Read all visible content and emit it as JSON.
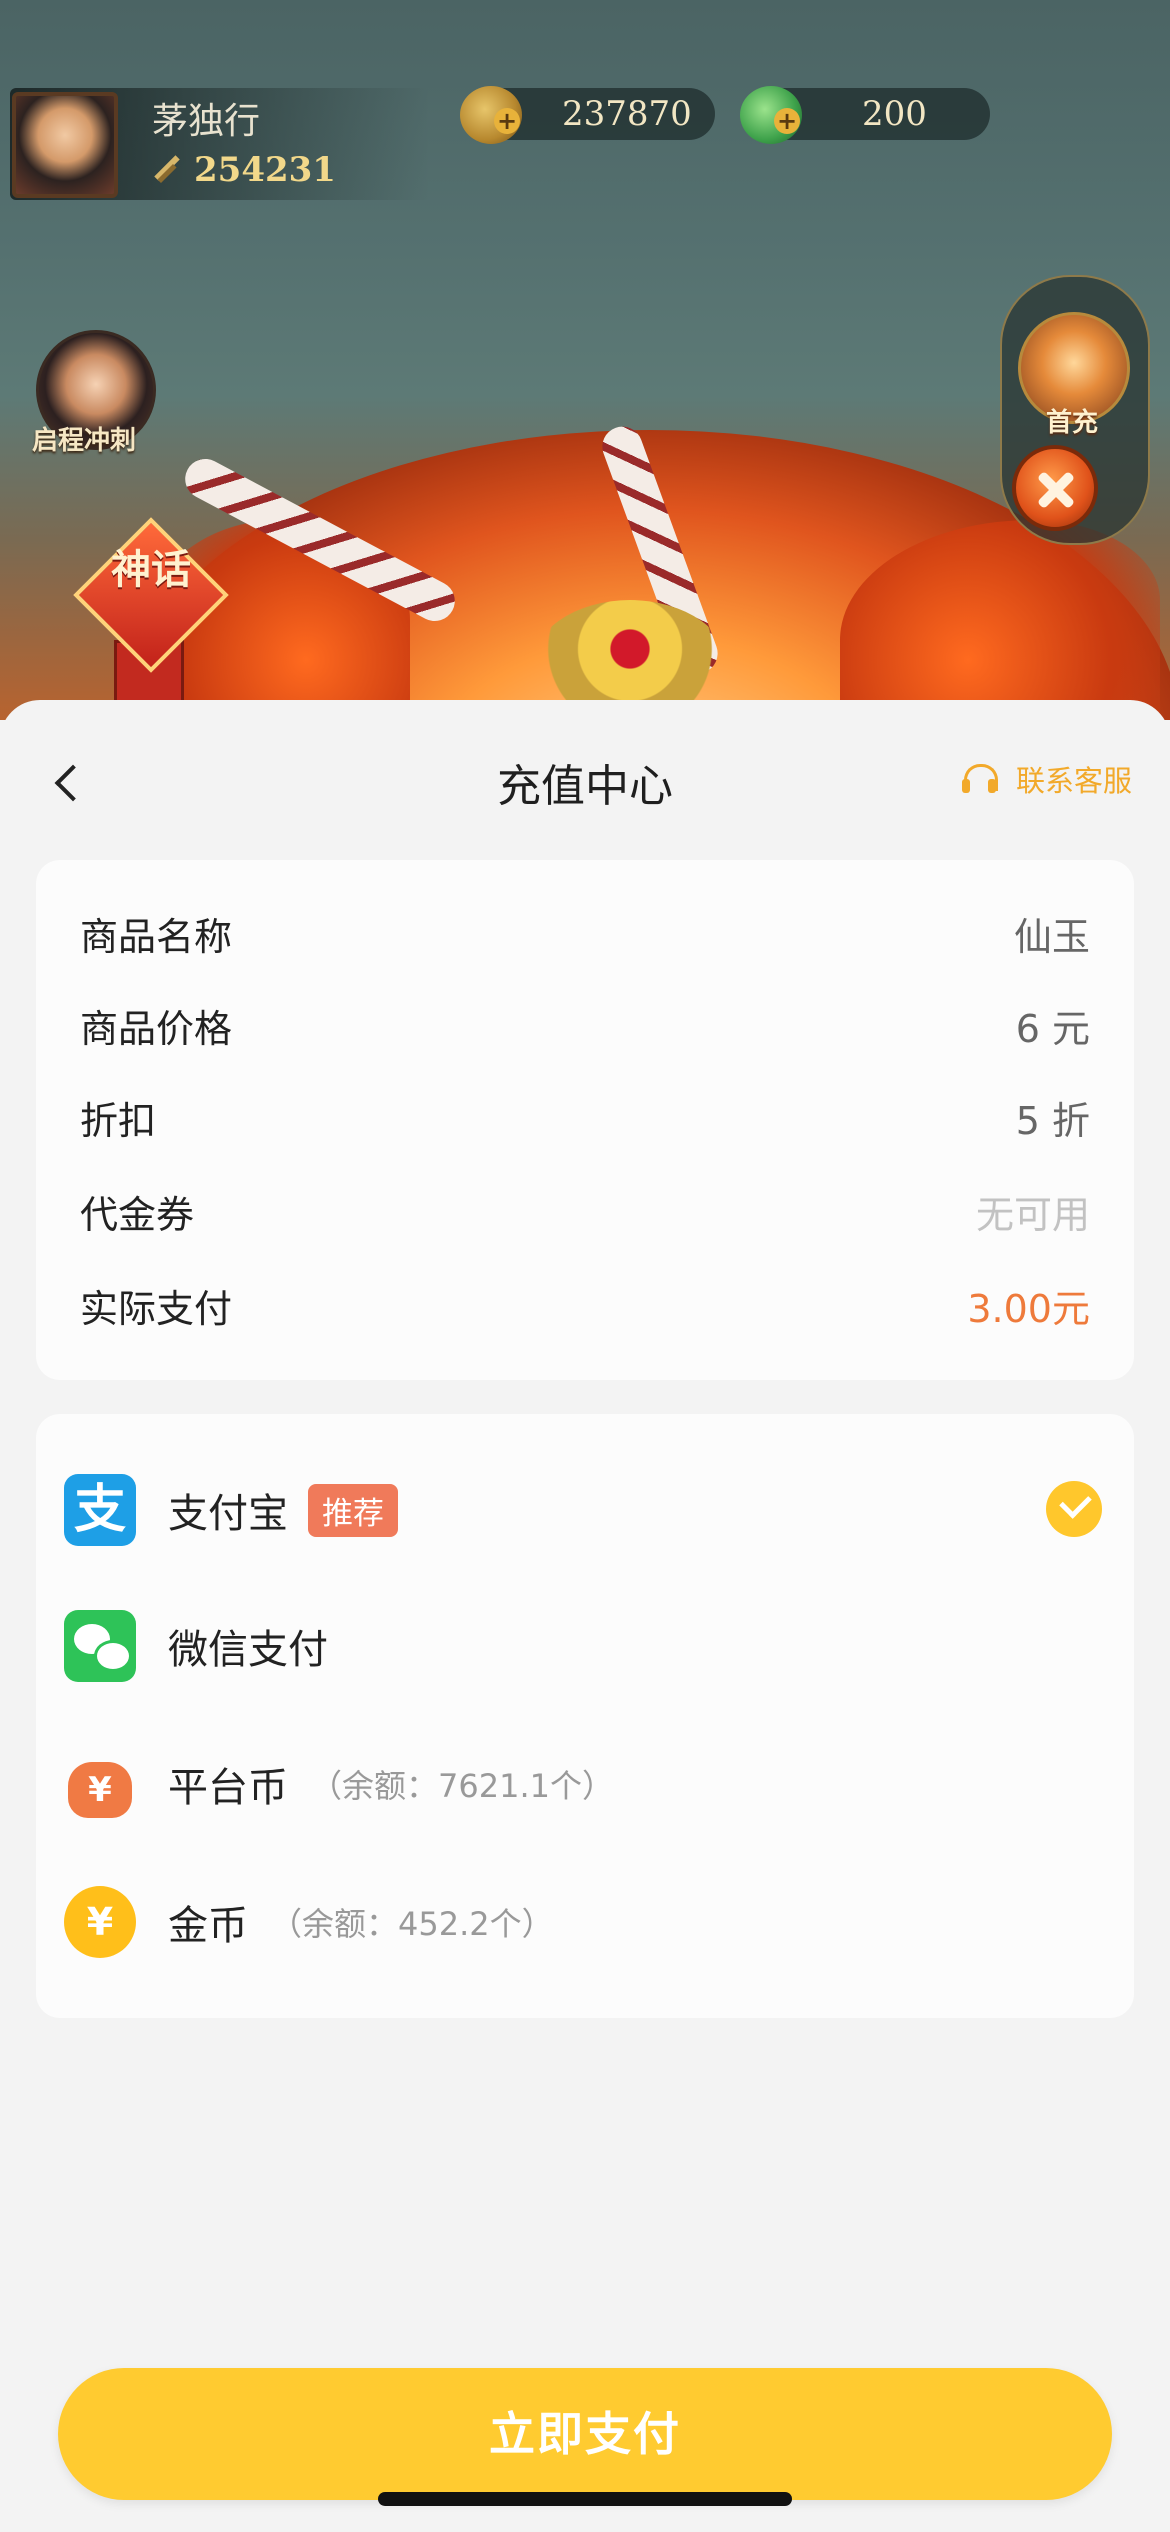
{
  "game": {
    "player_name": "茅独行",
    "power": "254231",
    "copper": "237870",
    "jade": "200",
    "event_label": "启程冲刺",
    "first_recharge_label": "首充",
    "myth_label": "神话"
  },
  "sheet": {
    "title": "充值中心",
    "customer_service": "联系客服"
  },
  "order": [
    {
      "label": "商品名称",
      "value": "仙玉"
    },
    {
      "label": "商品价格",
      "value": "6 元"
    },
    {
      "label": "折扣",
      "value": "5 折"
    },
    {
      "label": "代金券",
      "value": "无可用"
    },
    {
      "label": "实际支付",
      "value": "3.00元"
    }
  ],
  "payment": {
    "alipay": {
      "name": "支付宝",
      "badge": "推荐",
      "icon": "alipay-icon",
      "selected": true
    },
    "wechat": {
      "name": "微信支付",
      "icon": "wechat-icon"
    },
    "platform": {
      "name": "平台币",
      "note": "（余额：7621.1个）",
      "icon": "bag-icon"
    },
    "gold": {
      "name": "金币",
      "note": "（余额：452.2个）",
      "icon": "gold-coin-icon"
    }
  },
  "pay_button": "立即支付",
  "colors": {
    "accent": "#ffcb30",
    "price": "#ee7a3b",
    "alipay": "#1e9fe6",
    "wechat": "#2ec358"
  }
}
